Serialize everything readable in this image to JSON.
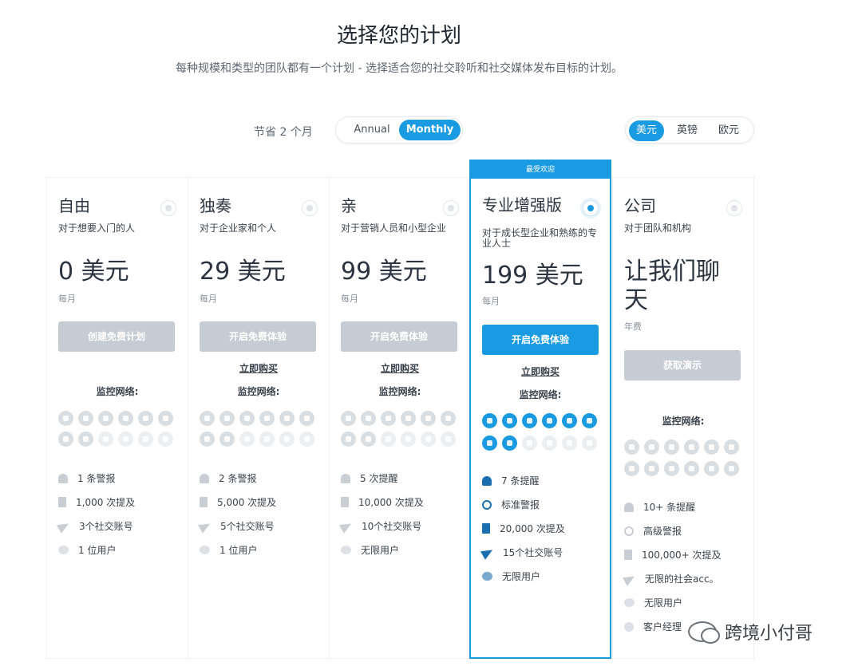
{
  "header": {
    "title": "选择您的计划",
    "subtitle": "每种规模和类型的团队都有一个计划 - 选择适合您的社交聆听和社交媒体发布目标的计划。"
  },
  "billing": {
    "save_label": "节省 2 个月",
    "annual_label": "Annual",
    "monthly_label": "Monthly",
    "selected": "Monthly"
  },
  "currency": {
    "options": [
      "美元",
      "英镑",
      "欧元"
    ],
    "selected": "美元"
  },
  "colors": {
    "accent": "#1a9ae0",
    "disabled_button": "#c5ccd3"
  },
  "plans": [
    {
      "name": "自由",
      "desc": "对于想要入门的人",
      "price": "0 美元",
      "period": "每月",
      "cta": "创建免费计划",
      "buy": "",
      "net_label": "监控网络:",
      "features": [
        "1 条警报",
        "1,000 次提及",
        "3个社交账号",
        "1 位用户"
      ]
    },
    {
      "name": "独奏",
      "desc": "对于企业家和个人",
      "price": "29 美元",
      "period": "每月",
      "cta": "开启免费体验",
      "buy": "立即购买",
      "net_label": "监控网络:",
      "features": [
        "2 条警报",
        "5,000 次提及",
        "5个社交账号",
        "1 位用户"
      ]
    },
    {
      "name": "亲",
      "desc": "对于营销人员和小型企业",
      "price": "99 美元",
      "period": "每月",
      "cta": "开启免费体验",
      "buy": "立即购买",
      "net_label": "监控网络:",
      "features": [
        "5 次提醒",
        "10,000 次提及",
        "10个社交账号",
        "无限用户"
      ]
    },
    {
      "name": "专业增强版",
      "ribbon": "最受欢迎",
      "desc": "对于成长型企业和熟练的专业人士",
      "price": "199 美元",
      "period": "每月",
      "cta": "开启免费体验",
      "buy": "立即购买",
      "net_label": "监控网络:",
      "features": [
        "7 条提醒",
        "标准警报",
        "20,000 次提及",
        "15个社交账号",
        "无限用户"
      ]
    },
    {
      "name": "公司",
      "desc": "对于团队和机构",
      "price": "让我们聊天",
      "period": "年费",
      "cta": "获取演示",
      "buy": "",
      "net_label": "监控网络:",
      "features": [
        "10+ 条提醒",
        "高级警报",
        "100,000+ 次提及",
        "无限的社会acc。",
        "无限用户",
        "客户经理"
      ]
    }
  ],
  "watermark": {
    "text": "跨境小付哥"
  }
}
